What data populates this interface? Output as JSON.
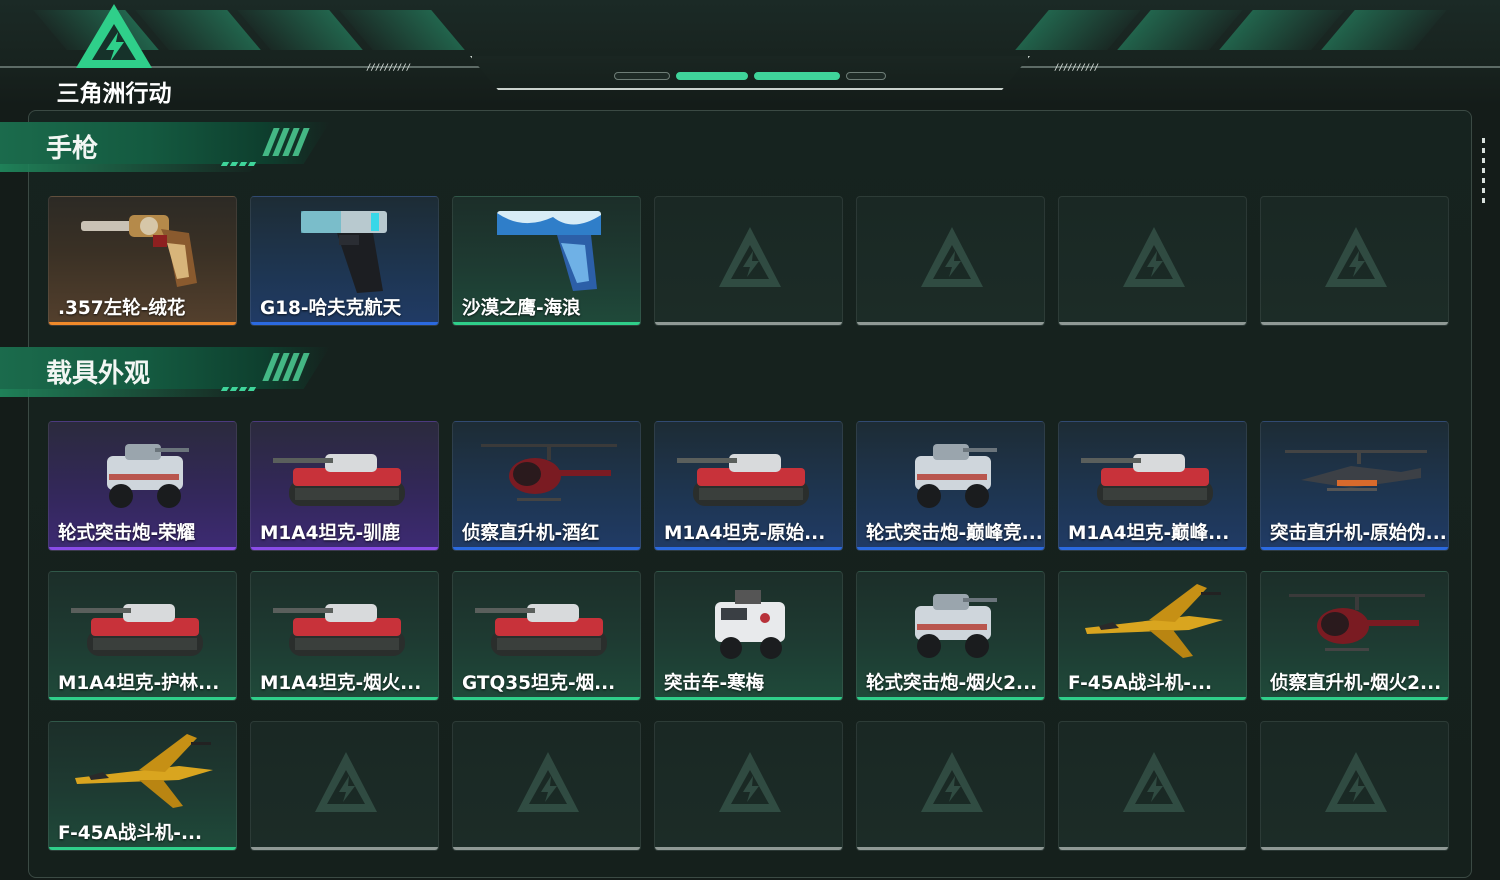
{
  "app": {
    "logo_text": "三角洲行动",
    "accent": "#3fd49a"
  },
  "sections": [
    {
      "title": "手枪",
      "items": [
        {
          "name": ".357左轮-绒花",
          "rarity": "orange",
          "icon": "revolver-icon"
        },
        {
          "name": "G18-哈夫克航天",
          "rarity": "blue",
          "icon": "pistol-icon"
        },
        {
          "name": "沙漠之鹰-海浪",
          "rarity": "green",
          "icon": "desert-eagle-icon"
        },
        {
          "empty": true
        },
        {
          "empty": true
        },
        {
          "empty": true
        },
        {
          "empty": true
        }
      ]
    },
    {
      "title": "载具外观",
      "items": [
        {
          "name": "轮式突击炮-荣耀",
          "rarity": "purple",
          "icon": "armored-car-icon"
        },
        {
          "name": "M1A4坦克-驯鹿",
          "rarity": "purple",
          "icon": "tank-icon"
        },
        {
          "name": "侦察直升机-酒红",
          "rarity": "blue",
          "icon": "helicopter-icon"
        },
        {
          "name": "M1A4坦克-原始...",
          "rarity": "blue",
          "icon": "tank-icon"
        },
        {
          "name": "轮式突击炮-巅峰竞...",
          "rarity": "blue",
          "icon": "armored-car-icon"
        },
        {
          "name": "M1A4坦克-巅峰...",
          "rarity": "blue",
          "icon": "tank-icon"
        },
        {
          "name": "突击直升机-原始伪...",
          "rarity": "blue",
          "icon": "attack-helicopter-icon"
        },
        {
          "name": "M1A4坦克-护林...",
          "rarity": "green",
          "icon": "tank-icon"
        },
        {
          "name": "M1A4坦克-烟火...",
          "rarity": "green",
          "icon": "tank-icon"
        },
        {
          "name": "GTQ35坦克-烟...",
          "rarity": "green",
          "icon": "tank-icon"
        },
        {
          "name": "突击车-寒梅",
          "rarity": "green",
          "icon": "assault-vehicle-icon"
        },
        {
          "name": "轮式突击炮-烟火2...",
          "rarity": "green",
          "icon": "armored-car-icon"
        },
        {
          "name": "F-45A战斗机-...",
          "rarity": "green",
          "icon": "fighter-jet-icon"
        },
        {
          "name": "侦察直升机-烟火2...",
          "rarity": "green",
          "icon": "helicopter-icon"
        },
        {
          "name": "F-45A战斗机-...",
          "rarity": "green",
          "icon": "fighter-jet-icon"
        },
        {
          "empty": true
        },
        {
          "empty": true
        },
        {
          "empty": true
        },
        {
          "empty": true
        },
        {
          "empty": true
        },
        {
          "empty": true
        }
      ]
    }
  ]
}
